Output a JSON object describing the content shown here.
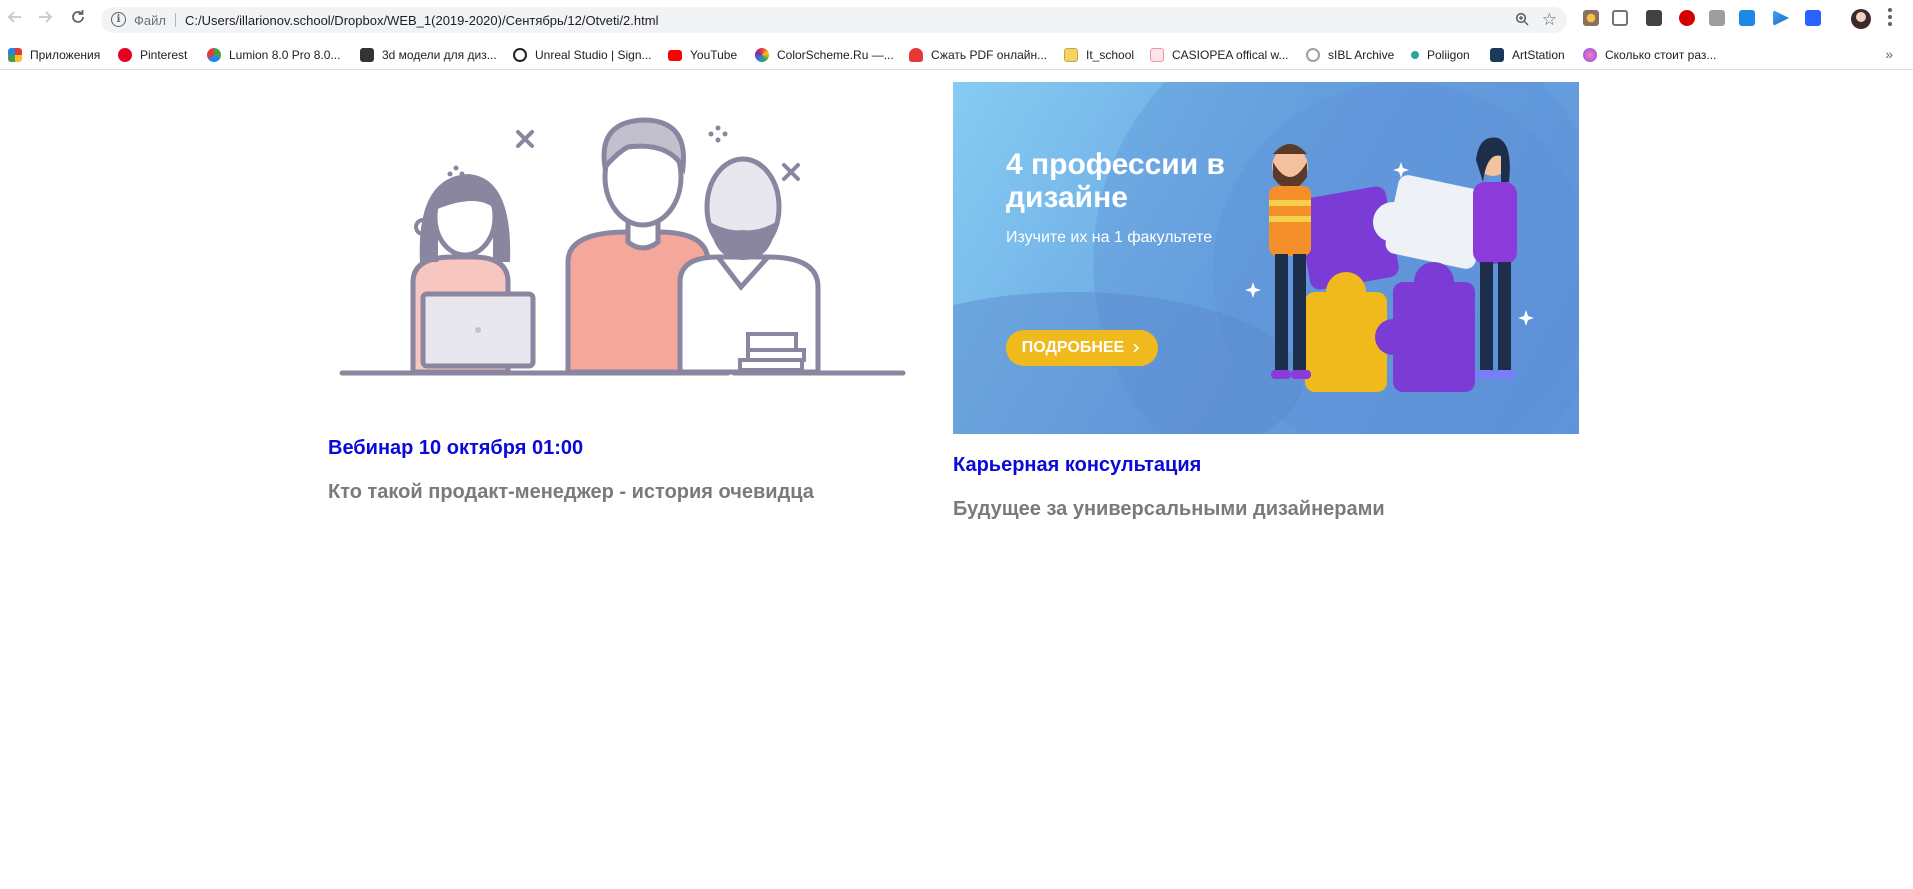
{
  "browser": {
    "nav": {
      "back_icon": "arrow-left-icon",
      "forward_icon": "arrow-right-icon",
      "reload_icon": "reload-icon"
    },
    "omnibox": {
      "scheme_label": "Файл",
      "url": "C:/Users/illarionov.school/Dropbox/WEB_1(2019-2020)/Сентябрь/12/Otveti/2.html"
    },
    "bookmarks": [
      {
        "label": "Приложения",
        "icon": "apps-grid-icon",
        "color": "#e53935"
      },
      {
        "label": "Pinterest",
        "icon": "pinterest-icon",
        "color": "#e60023"
      },
      {
        "label": "Lumion 8.0 Pro 8.0...",
        "icon": "lumion-icon",
        "color": "#43a047"
      },
      {
        "label": "3d модели для диз...",
        "icon": "3ddd-icon",
        "color": "#333333"
      },
      {
        "label": "Unreal Studio | Sign...",
        "icon": "unreal-icon",
        "color": "#222222"
      },
      {
        "label": "YouTube",
        "icon": "youtube-icon",
        "color": "#ff0000"
      },
      {
        "label": "ColorScheme.Ru —...",
        "icon": "colorscheme-icon",
        "color": "#fb8c00"
      },
      {
        "label": "Сжать PDF онлайн...",
        "icon": "pdf-heart-icon",
        "color": "#e53935"
      },
      {
        "label": "It_school",
        "icon": "folder-icon",
        "color": "#f6d365"
      },
      {
        "label": "CASIOPEA offical w...",
        "icon": "casiopea-icon",
        "color": "#ef9a9a"
      },
      {
        "label": "sIBL Archive",
        "icon": "sibl-icon",
        "color": "#9e9e9e"
      },
      {
        "label": "Poliigon",
        "icon": "poliigon-icon",
        "color": "#26a69a"
      },
      {
        "label": "ArtStation",
        "icon": "artstation-icon",
        "color": "#1a3a5c"
      },
      {
        "label": "Сколько стоит раз...",
        "icon": "site-globe-icon",
        "color": "#7c4dff"
      }
    ],
    "bookmarks_more": "»"
  },
  "cards": [
    {
      "title": "Вебинар 10 октября 01:00",
      "subtitle": "Кто такой продакт-менеджер - история очевидца",
      "image": "team-illustration"
    },
    {
      "title": "Карьерная консультация",
      "subtitle": "Будущее за универсальными дизайнерами",
      "banner": {
        "heading": "4 профессии в дизайне",
        "text": "Изучите их на 1 факультете",
        "button": "ПОДРОБНЕЕ"
      }
    }
  ],
  "colors": {
    "link": "#0a09d9",
    "muted_text": "#7a7a7a",
    "banner_bg": "#6aa7e3",
    "banner_button": "#f0b91c"
  }
}
